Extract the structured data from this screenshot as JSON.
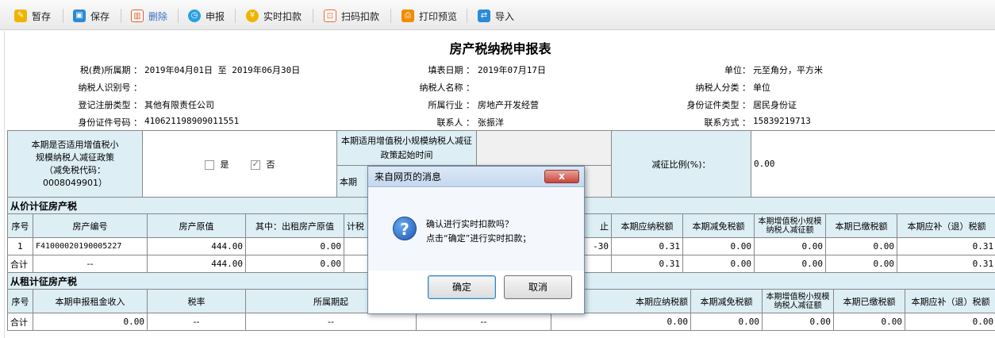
{
  "toolbar": {
    "save_draft": "暂存",
    "save": "保存",
    "delete": "删除",
    "declare": "申报",
    "realtime_deduct": "实时扣款",
    "scan_deduct": "扫码扣款",
    "print_preview": "打印预览",
    "import": "导入"
  },
  "form": {
    "title": "房产税纳税申报表",
    "tax_period_label": "税(费)所属期 ：",
    "tax_period_value": "2019年04月01日 至 2019年06月30日",
    "fill_date_label": "填表日期 ：",
    "fill_date_value": "2019年07月17日",
    "unit_label": "单位：",
    "unit_value": "元至角分，平方米",
    "taxpayer_id_label": "纳税人识别号 ：",
    "taxpayer_id_value": "",
    "taxpayer_name_label": "纳税人名称 ：",
    "taxpayer_name_value": "",
    "taxpayer_class_label": "纳税人分类 ：",
    "taxpayer_class_value": "单位",
    "reg_type_label": "登记注册类型 ：",
    "reg_type_value": "其他有限责任公司",
    "industry_label": "所属行业 ：",
    "industry_value": "房地产开发经营",
    "id_type_label": "身份证件类型 ：",
    "id_type_value": "居民身份证",
    "id_no_label": "身份证件号码 ：",
    "id_no_value": "410621198909011551",
    "contact_label": "联系人 ：",
    "contact_value": "张振洋",
    "phone_label": "联系方式 ：",
    "phone_value": "15839219713"
  },
  "policy": {
    "question": "本期是否适用增值税小规模纳税人减征政策（减免税代码：0008049901）",
    "yes_label": "是",
    "no_label": "否",
    "yes_checked": false,
    "no_checked": true,
    "start_label": "本期适用增值税小规模纳税人减征政策起始时间",
    "start_label2": "本期",
    "ratio_label": "减征比例(%)：",
    "ratio_value": "0.00"
  },
  "section1": {
    "title": "从价计征房产税",
    "headers": [
      "序号",
      "房产编号",
      "房产原值",
      "其中：出租房产原值",
      "计税",
      "止",
      "本期应纳税额",
      "本期减免税额",
      "本期增值税小规模纳税人减征额",
      "本期已缴税额",
      "本期应补（退）税额"
    ],
    "rows": [
      [
        "1",
        "F41000020190005227",
        "444.00",
        "0.00",
        "-30",
        "0.31",
        "0.00",
        "0.00",
        "0.00",
        "0.31"
      ]
    ],
    "total": [
      "合计",
      "--",
      "444.00",
      "0.00",
      "",
      "0.31",
      "0.00",
      "0.00",
      "0.00",
      "0.31"
    ]
  },
  "section2": {
    "title": "从租计征房产税",
    "headers": [
      "序号",
      "本期申报租金收入",
      "税率",
      "所属期起",
      "本期应纳税额",
      "本期减免税额",
      "本期增值税小规模纳税人减征额",
      "本期已缴税额",
      "本期应补（退）税额"
    ],
    "total": [
      "合计",
      "0.00",
      "--",
      "--",
      "--",
      "0.00",
      "0.00",
      "0.00",
      "0.00",
      "0.00"
    ]
  },
  "dialog": {
    "title": "来自网页的消息",
    "close": "x",
    "line1": "确认进行实时扣款吗？",
    "line2": "点击“确定”进行实时扣款；",
    "ok": "确定",
    "cancel": "取消"
  }
}
